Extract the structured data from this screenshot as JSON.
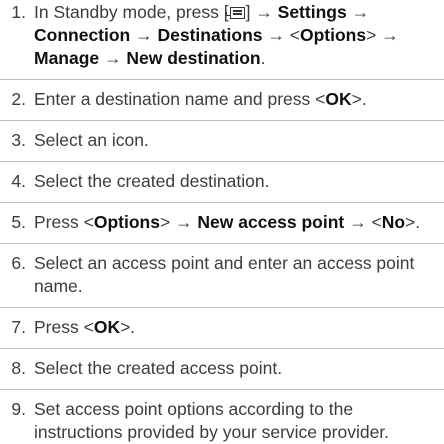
{
  "steps": [
    {
      "number": "1.",
      "parts": [
        "In Standby mode, press [",
        "menu-key-icon",
        "] → ",
        "Settings",
        " → ",
        "Connection",
        " → ",
        "Destinations",
        " → <",
        "Options",
        "> → ",
        "Manage",
        " → ",
        "New destination",
        "."
      ]
    },
    {
      "number": "2.",
      "parts": [
        "Enter a destination name and press <",
        "OK",
        ">."
      ]
    },
    {
      "number": "3.",
      "parts": [
        "Select an icon."
      ]
    },
    {
      "number": "4.",
      "parts": [
        "Select the created destination."
      ]
    },
    {
      "number": "5.",
      "parts": [
        "Press <",
        "Options",
        "> → ",
        "New access point",
        " → <",
        "No",
        ">."
      ]
    },
    {
      "number": "6.",
      "parts": [
        "Select an access point and enter an access point name."
      ]
    },
    {
      "number": "7.",
      "parts": [
        "Press <",
        "OK",
        ">."
      ]
    },
    {
      "number": "8.",
      "parts": [
        "Select the created access point."
      ]
    },
    {
      "number": "9.",
      "parts": [
        "Set access point options according to the instructions provided by your service provider."
      ]
    }
  ],
  "icons": {
    "menu_key": "menu-key-icon"
  }
}
